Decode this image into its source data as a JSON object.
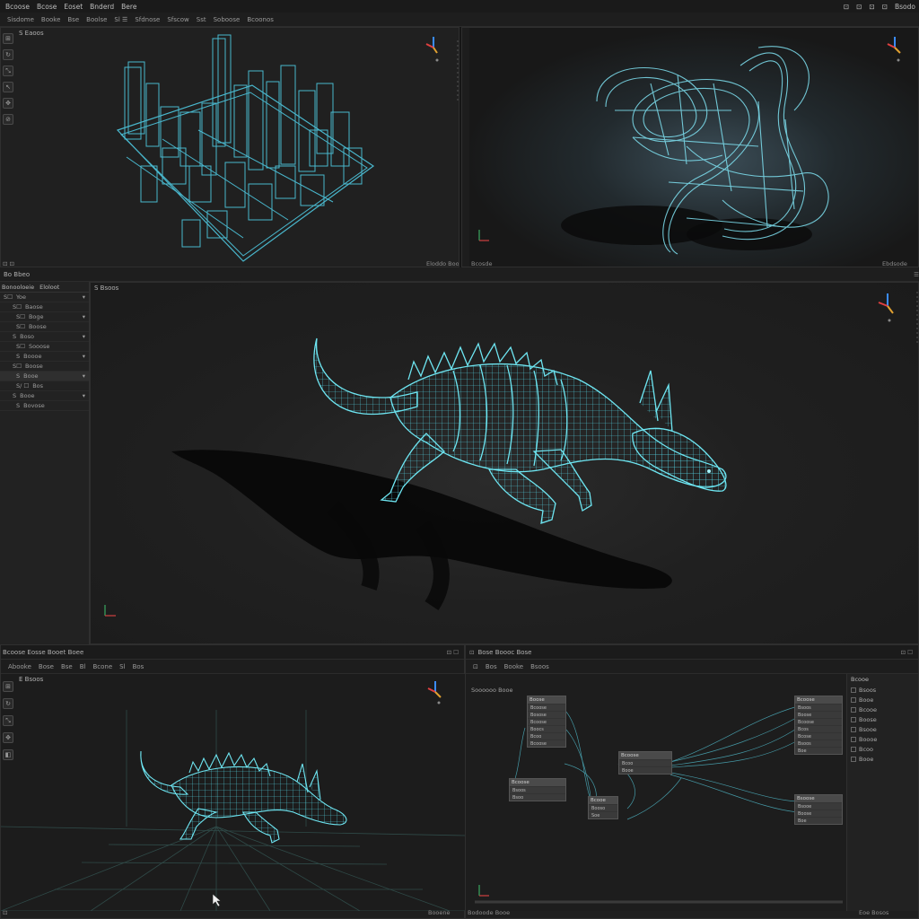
{
  "menubar": {
    "items": [
      "Bcoose",
      "Bcose",
      "Eoset",
      "Bnderd",
      "Bere"
    ],
    "right_items": [
      "⊡",
      "⊡",
      "⊡",
      "⊡",
      "Bsodo"
    ]
  },
  "toolbar": {
    "items": [
      "Sisdome",
      "Booke",
      "Bse",
      "Boolse",
      "Sl ☰",
      "Sfdnose",
      "Sfscow",
      "Sst",
      "Soboose",
      "Bcoonos"
    ]
  },
  "viewport_tl": {
    "label": "S Eaoos",
    "status_right": "Eloddo Boo"
  },
  "viewport_tr": {
    "status_left": "Bcosde",
    "status_right": "Ebdsode"
  },
  "viewport_main": {
    "header_left": "Bo Bbeo",
    "label": "S Bsoos"
  },
  "outliner": {
    "header_tabs": [
      "Bonooloeie",
      "Eloloot"
    ],
    "rows": [
      {
        "icon": "S☐",
        "text": "Yoe",
        "selected": false
      },
      {
        "icon": "S☐",
        "text": "Baose",
        "selected": false
      },
      {
        "icon": "S☐",
        "text": "Boge",
        "selected": false
      },
      {
        "icon": "S☐",
        "text": "Boose",
        "selected": false
      },
      {
        "icon": "S",
        "text": "Boso",
        "selected": false
      },
      {
        "icon": "S☐",
        "text": "Sooose",
        "selected": false
      },
      {
        "icon": "S",
        "text": "Boooe",
        "selected": false
      },
      {
        "icon": "S☐",
        "text": "Boose",
        "selected": false
      },
      {
        "icon": "S",
        "text": "Booe",
        "selected": true
      },
      {
        "icon": "S/ ☐",
        "text": "Bos",
        "selected": false
      },
      {
        "icon": "S",
        "text": "Booe",
        "selected": false
      },
      {
        "icon": "S",
        "text": "Bovose",
        "selected": false
      }
    ],
    "extra_label": "Boo"
  },
  "bottom_left": {
    "title": "Bcoose Eosse Booet Boee",
    "tabs": [
      "Abooke",
      "Bose",
      "Bse",
      "Bl",
      "Bcone",
      "Sl",
      "Bos"
    ],
    "label": "E Bsoos",
    "status": "Booene"
  },
  "bottom_right": {
    "title": "Bose Boooc Bose",
    "tabs": [
      "Bos",
      "Booke",
      "Bsoos"
    ],
    "sub_label": "Soooooo",
    "sub_label2": "Booe",
    "status_left": "Bodoode Booe",
    "status_right": "Eoe Bosos"
  },
  "node_editor": {
    "nodes": [
      {
        "title": "Boose",
        "slots": [
          "Bcoose",
          "Bosose",
          "Bcoose",
          "Boocs",
          "Bcoo",
          "Bcoose"
        ]
      },
      {
        "title": "Bcoose",
        "slots": [
          "Bsoos",
          "Bsoo"
        ]
      },
      {
        "title": "Bcooe",
        "slots": [
          "Booso",
          "Soe"
        ]
      },
      {
        "title": "Bcoose",
        "slots": [
          "Bcoo",
          "Booe"
        ]
      },
      {
        "title": "Bcoose",
        "slots": [
          "Bsoos",
          "Boose",
          "Bcoose",
          "Bcos",
          "Bcose",
          "Bsoos",
          "Boe"
        ]
      },
      {
        "title": "Bsoose",
        "slots": [
          "Bsooe",
          "Boose",
          "Boe"
        ]
      }
    ]
  },
  "properties": {
    "title": "Bcooe",
    "rows": [
      "Bsoos",
      "Booe",
      "Bcooe",
      "Boose",
      "Bsooe",
      "Boooe",
      "Bcoo",
      "Booe"
    ]
  }
}
